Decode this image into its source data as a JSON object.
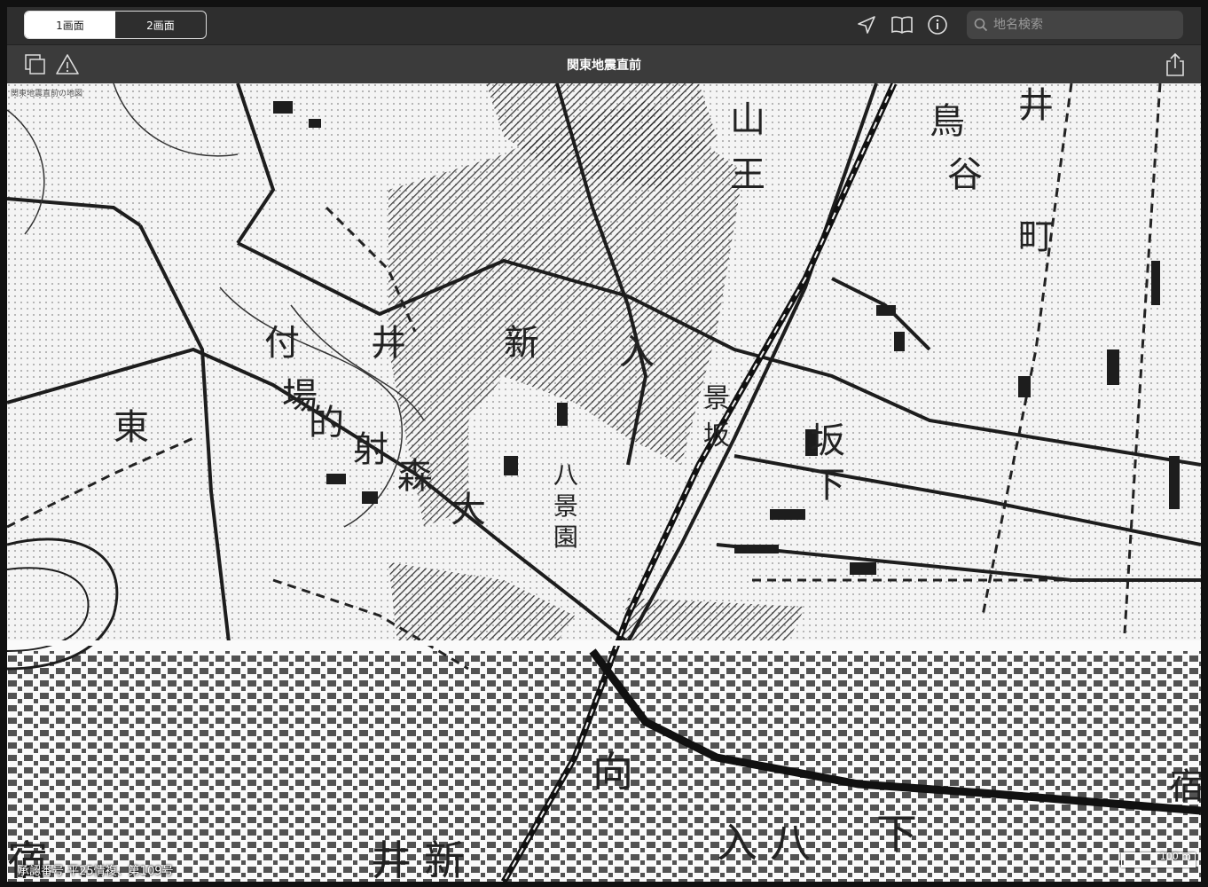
{
  "tabs": [
    {
      "label": "1画面",
      "active": true
    },
    {
      "label": "2画面",
      "active": false
    }
  ],
  "search": {
    "placeholder": "地名検索"
  },
  "toolbar": {
    "title": "関東地震直前"
  },
  "icons": [
    "location-arrow-icon",
    "book-icon",
    "info-icon",
    "search-icon",
    "copy-icon",
    "warning-icon",
    "share-icon"
  ],
  "map": {
    "source_label": "関東地震直前の地図",
    "approval_text": "承認番号 平25情複、第109号",
    "scale_label": "100 m",
    "place_labels": [
      "山",
      "王",
      "井",
      "鳥",
      "谷",
      "町",
      "井",
      "新",
      "入",
      "付",
      "場",
      "的",
      "射",
      "森",
      "大",
      "東",
      "八",
      "景",
      "園",
      "坂",
      "下",
      "景",
      "坂",
      "向",
      "宿",
      "井",
      "新",
      "八",
      "下",
      "入",
      "宿"
    ]
  },
  "colors": {
    "topbar": "#2e2e2e",
    "navbar": "#3b3b3b",
    "map_bg": "#f2f2f2",
    "ink": "#222222"
  }
}
